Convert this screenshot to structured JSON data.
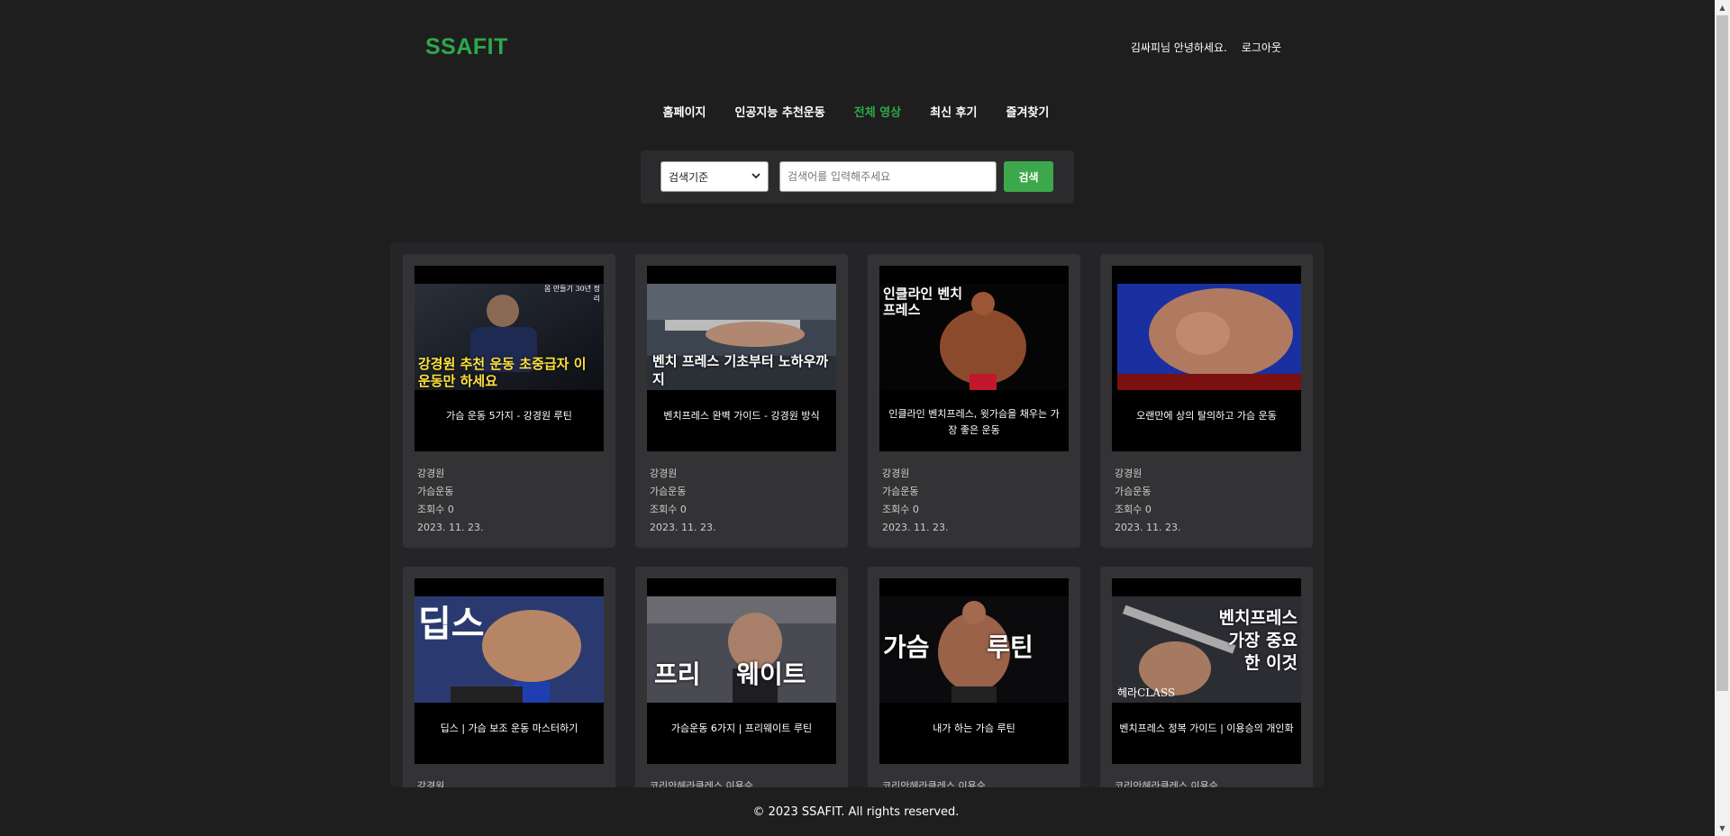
{
  "header": {
    "logo": "SSAFIT",
    "greeting": "김싸피님 안녕하세요.",
    "logout": "로그아웃"
  },
  "nav": {
    "items": [
      {
        "label": "홈페이지"
      },
      {
        "label": "인공지능 추천운동"
      },
      {
        "label": "전체 영상"
      },
      {
        "label": "최신 후기"
      },
      {
        "label": "즐겨찾기"
      }
    ],
    "active": "전체 영상"
  },
  "search": {
    "select_value": "검색기준",
    "placeholder": "검색어를 입력해주세요",
    "button": "검색"
  },
  "videos": [
    {
      "title": "가슴 운동 5가지 - 강경원 루틴",
      "channel": "강경원",
      "part": "가슴운동",
      "views": "조회수 0",
      "date": "2023. 11. 23.",
      "thumb_text": "강경원 추천 운동 초중급자 이 운동만 하세요",
      "thumb_corner": "몸 만들기 30년 정리"
    },
    {
      "title": "벤치프레스 완벽 가이드 - 강경원 방식",
      "channel": "강경원",
      "part": "가슴운동",
      "views": "조회수 0",
      "date": "2023. 11. 23.",
      "thumb_text": "벤치 프레스 기초부터 노하우까지"
    },
    {
      "title": "인클라인 벤치프레스, 윗가슴을 채우는 가장 좋은 운동",
      "channel": "강경원",
      "part": "가슴운동",
      "views": "조회수 0",
      "date": "2023. 11. 23.",
      "thumb_text": "인클라인 벤치프레스"
    },
    {
      "title": "오랜만에 상의 탈의하고 가슴 운동",
      "channel": "강경원",
      "part": "가슴운동",
      "views": "조회수 0",
      "date": "2023. 11. 23.",
      "thumb_text": ""
    },
    {
      "title": "딥스 | 가슴 보조 운동 마스터하기",
      "channel": "강경원",
      "part": "",
      "views": "",
      "date": "",
      "thumb_text": "딥스"
    },
    {
      "title": "가슴운동 6가지 | 프리웨이트 루틴",
      "channel": "코리안헤라클레스 이용승",
      "part": "",
      "views": "",
      "date": "",
      "thumb_text": "프리 웨이트"
    },
    {
      "title": "내가 하는 가슴 루틴",
      "channel": "코리안헤라클레스 이용승",
      "part": "",
      "views": "",
      "date": "",
      "thumb_text": "가슴 루틴"
    },
    {
      "title": "벤치프레스 정복 가이드 | 이용승의 개인화",
      "channel": "코리안헤라클레스 이용승",
      "part": "",
      "views": "",
      "date": "",
      "thumb_text": "벤치프레스 가장 중요한 이것",
      "thumb_corner": "헤라CLASS"
    }
  ],
  "footer": {
    "text": "© 2023 SSAFIT. All rights reserved."
  },
  "colors": {
    "background": "#1e1e1f",
    "accent": "#2ea84a",
    "search_button": "#3ca84b"
  }
}
